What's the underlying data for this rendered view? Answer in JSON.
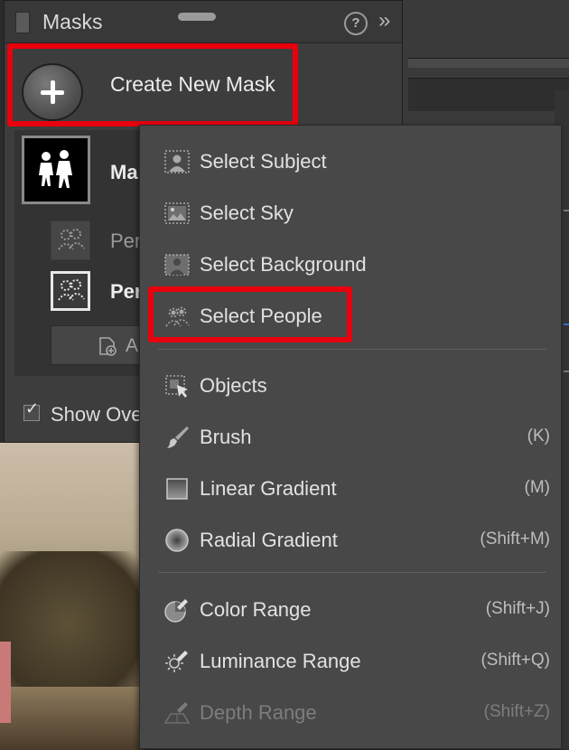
{
  "panel": {
    "title": "Masks",
    "help_icon": "?",
    "expand_icon": "»",
    "create_button_label": "Create New Mask",
    "mask_name_partial": "Ma",
    "sub_masks": [
      {
        "label_partial": "Per"
      },
      {
        "label_partial": "Per"
      }
    ],
    "add_button_partial": "A",
    "show_overlay_label_partial": "Show Ove",
    "show_overlay_checked": true
  },
  "menu": {
    "items": [
      {
        "label": "Select Subject",
        "shortcut": "",
        "icon": "select-subject-icon",
        "disabled": false
      },
      {
        "label": "Select Sky",
        "shortcut": "",
        "icon": "select-sky-icon",
        "disabled": false
      },
      {
        "label": "Select Background",
        "shortcut": "",
        "icon": "select-background-icon",
        "disabled": false
      },
      {
        "label": "Select People",
        "shortcut": "",
        "icon": "select-people-icon",
        "disabled": false
      },
      {
        "label": "Objects",
        "shortcut": "",
        "icon": "objects-icon",
        "disabled": false
      },
      {
        "label": "Brush",
        "shortcut": "(K)",
        "icon": "brush-icon",
        "disabled": false
      },
      {
        "label": "Linear Gradient",
        "shortcut": "(M)",
        "icon": "linear-gradient-icon",
        "disabled": false
      },
      {
        "label": "Radial Gradient",
        "shortcut": "(Shift+M)",
        "icon": "radial-gradient-icon",
        "disabled": false
      },
      {
        "label": "Color Range",
        "shortcut": "(Shift+J)",
        "icon": "color-range-icon",
        "disabled": false
      },
      {
        "label": "Luminance Range",
        "shortcut": "(Shift+Q)",
        "icon": "luminance-range-icon",
        "disabled": false
      },
      {
        "label": "Depth Range",
        "shortcut": "(Shift+Z)",
        "icon": "depth-range-icon",
        "disabled": true
      }
    ]
  },
  "colors": {
    "highlight": "#e8000d",
    "menu_bg": "#484848",
    "panel_bg": "#3d3d3d"
  }
}
